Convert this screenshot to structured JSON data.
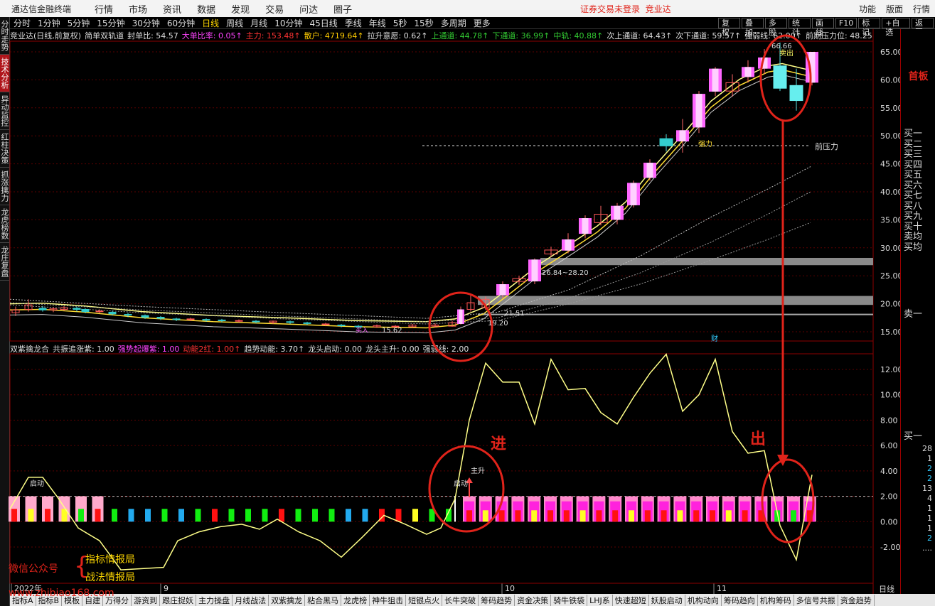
{
  "menubar": {
    "app_title": "通达信金融终端",
    "items": [
      "行情",
      "市场",
      "资讯",
      "数据",
      "发现",
      "交易",
      "问达",
      "圈子"
    ],
    "login_status": "证券交易未登录",
    "stock_name": "竞业达",
    "right_items": [
      "功能",
      "版面",
      "行情"
    ]
  },
  "periodbar": {
    "periods": [
      "分时",
      "1分钟",
      "5分钟",
      "15分钟",
      "30分钟",
      "60分钟",
      "日线",
      "周线",
      "月线",
      "10分钟",
      "45日线",
      "季线",
      "年线",
      "5秒",
      "15秒",
      "多周期",
      "更多"
    ],
    "active": "日线",
    "tools": [
      "复权",
      "叠加",
      "多股",
      "统计",
      "画线",
      "F10",
      "标记",
      "+自选",
      "返回"
    ]
  },
  "lefttabs": [
    "分时走势",
    "技术分析",
    "异动监控",
    "红柱决策",
    "抓涨擒力",
    "龙虎榜数",
    "龙庄复盘"
  ],
  "main_info": [
    {
      "t": "竞业达(日线,前复权)",
      "c": "#dddddd"
    },
    {
      "t": "简单双轨道",
      "c": "#dddddd"
    },
    {
      "t": "封单比: 54.57",
      "c": "#dddddd"
    },
    {
      "t": "大单比率: 0.05↑",
      "c": "#ff44ff"
    },
    {
      "t": "主力: 153.48↑",
      "c": "#ff3333"
    },
    {
      "t": "散户: 4719.64↑",
      "c": "#ffcc00"
    },
    {
      "t": "拉升意愿: 0.62↑",
      "c": "#dddddd"
    },
    {
      "t": "上通道: 44.78↑",
      "c": "#33cc33"
    },
    {
      "t": "下通道: 36.99↑",
      "c": "#33cc33"
    },
    {
      "t": "中轨: 40.88↑",
      "c": "#33cc33"
    },
    {
      "t": "次上通道: 64.43↑",
      "c": "#dddddd"
    },
    {
      "t": "次下通道: 59.57↑",
      "c": "#dddddd"
    },
    {
      "t": "强弱线: 62.00↑",
      "c": "#dddddd"
    },
    {
      "t": "前期压力位: 48.25",
      "c": "#dddddd"
    }
  ],
  "ind_info": [
    {
      "t": "双紫擒龙合",
      "c": "#dddddd"
    },
    {
      "t": "共振追涨紫: 1.00",
      "c": "#dddddd"
    },
    {
      "t": "强势起爆紫: 1.00",
      "c": "#ff44ff"
    },
    {
      "t": "动能2红: 1.00↑",
      "c": "#ff3333"
    },
    {
      "t": "趋势动能: 3.70↑",
      "c": "#dddddd"
    },
    {
      "t": "龙头启动: 0.00",
      "c": "#dddddd"
    },
    {
      "t": "龙头主升: 0.00",
      "c": "#dddddd"
    },
    {
      "t": "强弱线: 2.00",
      "c": "#dddddd"
    }
  ],
  "price_axis": [
    "65.00",
    "60.00",
    "55.00",
    "50.00",
    "45.00",
    "40.00",
    "35.00",
    "30.00",
    "25.00",
    "20.00",
    "15.00"
  ],
  "ind_axis": [
    "12.00",
    "10.00",
    "8.00",
    "6.00",
    "4.00",
    "2.00",
    "0.00",
    "-2.00"
  ],
  "chart_labels": {
    "pressure": "前压力",
    "strong": "强力",
    "peak": "66.66",
    "low": "15.62",
    "range": "26.84~28.20",
    "v1": "21.51",
    "v2": "19.20",
    "enter": "进",
    "exit": "出",
    "start1": "启动",
    "start2": "启动",
    "mainrise": "主升",
    "buy_in": "买入",
    "sell_out": "卖出",
    "cai": "财"
  },
  "date_axis": [
    "2022年",
    "9",
    "10",
    "11"
  ],
  "right_panel": {
    "title": "首板",
    "buy_levels": [
      "买一",
      "买二",
      "买三",
      "买四",
      "买五",
      "买六",
      "买七",
      "买八",
      "买九",
      "买十",
      "卖均",
      "买均"
    ],
    "sell_one": "卖一",
    "buy_one": "买一",
    "volumes": [
      "28",
      "1",
      "2",
      "2",
      "13",
      "4",
      "1",
      "1",
      "1",
      "2",
      "...."
    ]
  },
  "bottom_tabs": [
    "指标A",
    "指标B",
    "模板",
    "自建",
    "万得分",
    "游资到",
    "跟庄捉妖",
    "主力操盘",
    "月线战法",
    "双紫擒龙",
    "粘合黑马",
    "龙虎榜",
    "神牛狙击",
    "短银点火",
    "长牛突破",
    "筹码趋势",
    "资金决策",
    "骑牛铁袋",
    "LHJ系",
    "快速超短",
    "妖股启动",
    "机构动向",
    "筹码趋向",
    "机构筹码",
    "多信号共振",
    "资金趋势"
  ],
  "day_label": "日线",
  "watermark": {
    "a": "微信公众号",
    "b": "指标情报局",
    "c": "战法情报局",
    "url": "www.zhibiao168.com"
  },
  "colors": {
    "up": "#ff44ff",
    "down": "#33dddd",
    "line": "#ffff88",
    "alert": "#e0231a"
  }
}
